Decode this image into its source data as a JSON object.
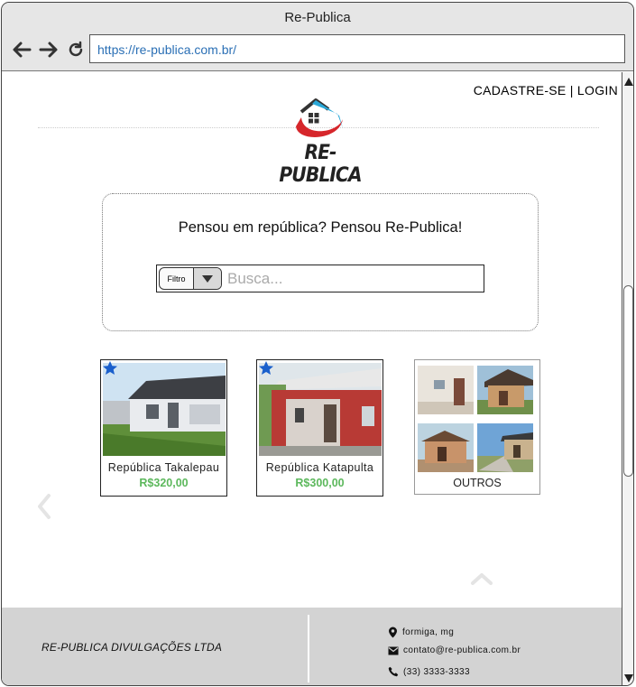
{
  "browser": {
    "title": "Re-Publica",
    "url": "https://re-publica.com.br/"
  },
  "header": {
    "signup_label": "CADASTRE-SE",
    "separator": "|",
    "login_label": "LOGIN",
    "logo_text": "RE-PUBLICA"
  },
  "search": {
    "headline": "Pensou em república? Pensou Re-Publica!",
    "filter_label": "Filtro",
    "placeholder": "Busca..."
  },
  "listings": [
    {
      "name": "República Takalepau",
      "price": "R$320,00",
      "featured_icon": "star-icon"
    },
    {
      "name": "República Katapulta",
      "price": "R$300,00",
      "featured_icon": "star-icon"
    }
  ],
  "others": {
    "label": "OUTROS"
  },
  "footer": {
    "company": "RE-PUBLICA DIVULGAÇÕES LTDA",
    "location": "formiga, mg",
    "email": "contato@re-publica.com.br",
    "phone": "(33) 3333-3333"
  },
  "colors": {
    "price_green": "#5cb85c",
    "star_blue": "#1a5fcc",
    "url_blue": "#2a6fb5",
    "footer_gray": "#d3d3d3",
    "logo_red": "#d6262b",
    "logo_cyan": "#2aa8d8"
  }
}
